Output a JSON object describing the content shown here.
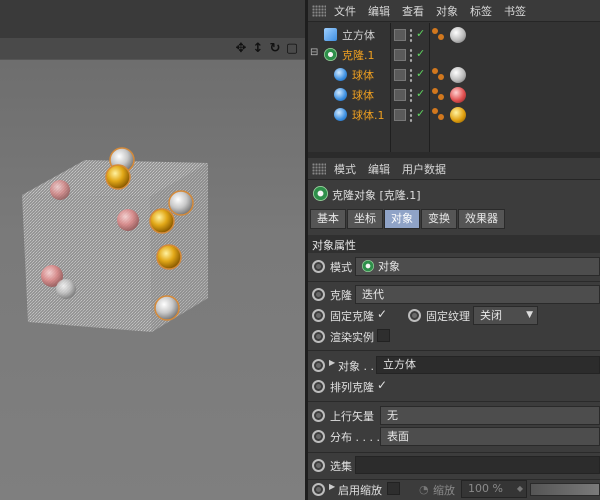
{
  "object_manager": {
    "menu": [
      "文件",
      "编辑",
      "查看",
      "对象",
      "标签",
      "书签"
    ],
    "objects": [
      {
        "name": "立方体",
        "color": "#dcdcdc",
        "icon": "cube-icon"
      },
      {
        "name": "克隆.1",
        "color": "#f0a020",
        "icon": "cloner-icon"
      },
      {
        "name": "球体",
        "color": "#f0a020",
        "icon": "sphere-icon"
      },
      {
        "name": "球体",
        "color": "#f0a020",
        "icon": "sphere-icon"
      },
      {
        "name": "球体.1",
        "color": "#f0a020",
        "icon": "sphere-icon"
      }
    ]
  },
  "attribute_manager": {
    "menu": [
      "模式",
      "编辑",
      "用户数据"
    ],
    "title": "克隆对象 [克隆.1]",
    "tabs": [
      "基本",
      "坐标",
      "对象",
      "变换",
      "效果器"
    ],
    "active_tab": "对象",
    "section": "对象属性",
    "mode_label": "模式",
    "mode_value": "对象",
    "clone_label": "克隆",
    "clone_value": "迭代",
    "fixed_clone_label": "固定克隆",
    "fixed_clone_checked": "✓",
    "fixed_texture_label": "固定纹理",
    "fixed_texture_value": "关闭",
    "render_instances_label": "渲染实例",
    "object_label": "对象 . .",
    "object_value": "立方体",
    "arrange_label": "排列克隆",
    "arrange_checked": "✓",
    "upvector_label": "上行矢量",
    "upvector_value": "无",
    "distribution_label": "分布 . . . .",
    "distribution_value": "表面",
    "selection_label": "选集",
    "enable_scale_label": "启用缩放",
    "scale_label": "缩放",
    "scale_value": "100 %"
  },
  "colors": {
    "accent_tab": "#8fa3c7",
    "active_name": "#f0a020",
    "check_green": "#5ed35e"
  }
}
